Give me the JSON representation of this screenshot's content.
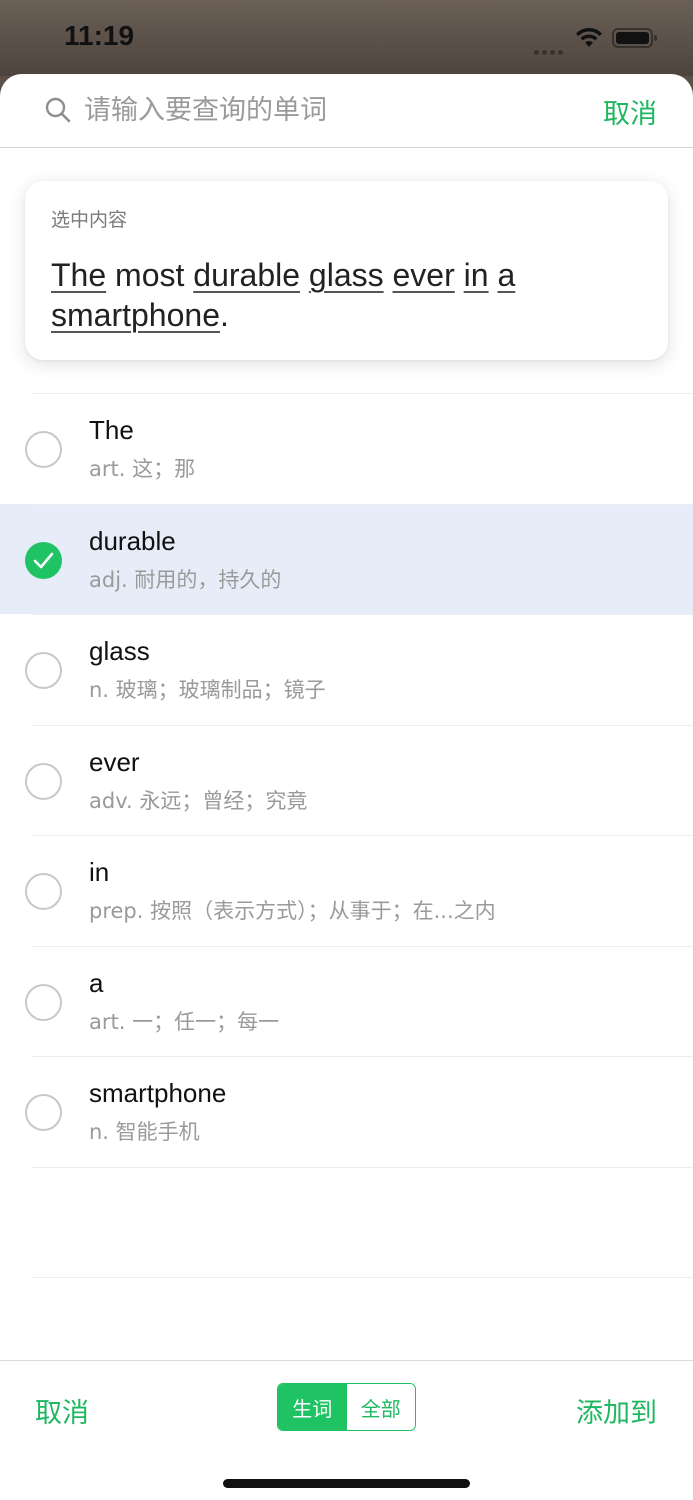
{
  "status_bar": {
    "time": "11:19"
  },
  "search": {
    "placeholder": "请输入要查询的单词",
    "cancel_label": "取消"
  },
  "selection": {
    "label": "选中内容",
    "sentence_tokens": [
      {
        "text": "The",
        "underlined": true
      },
      {
        "text": " most ",
        "underlined": false
      },
      {
        "text": "durable",
        "underlined": true
      },
      {
        "text": " ",
        "underlined": false
      },
      {
        "text": "glass",
        "underlined": true
      },
      {
        "text": " ",
        "underlined": false
      },
      {
        "text": "ever",
        "underlined": true
      },
      {
        "text": " ",
        "underlined": false
      },
      {
        "text": "in",
        "underlined": true
      },
      {
        "text": " ",
        "underlined": false
      },
      {
        "text": "a",
        "underlined": true
      },
      {
        "text": " ",
        "underlined": false
      },
      {
        "text": "smartphone",
        "underlined": true
      },
      {
        "text": ".",
        "underlined": false
      }
    ]
  },
  "words": [
    {
      "term": "The",
      "meaning": "art. 这；那",
      "selected": false
    },
    {
      "term": "durable",
      "meaning": "adj. 耐用的，持久的",
      "selected": true
    },
    {
      "term": "glass",
      "meaning": "n. 玻璃；玻璃制品；镜子",
      "selected": false
    },
    {
      "term": "ever",
      "meaning": "adv. 永远；曾经；究竟",
      "selected": false
    },
    {
      "term": "in",
      "meaning": "prep. 按照（表示方式）；从事于；在...之内",
      "selected": false
    },
    {
      "term": "a",
      "meaning": "art. 一；任一；每一",
      "selected": false
    },
    {
      "term": "smartphone",
      "meaning": "n. 智能手机",
      "selected": false
    }
  ],
  "bottom_bar": {
    "cancel_label": "取消",
    "segments": [
      {
        "label": "生词",
        "active": true
      },
      {
        "label": "全部",
        "active": false
      }
    ],
    "add_label": "添加到"
  },
  "colors": {
    "accent": "#1fb760",
    "check_fill": "#1fc363",
    "selected_row_bg": "#e6edf8"
  }
}
